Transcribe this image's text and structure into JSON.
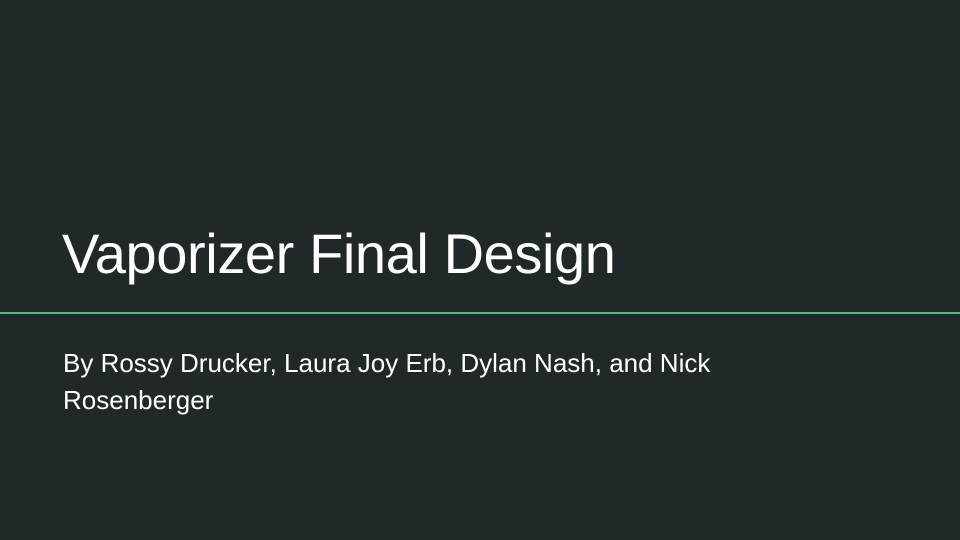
{
  "slide": {
    "title": "Vaporizer Final Design",
    "subtitle": "By Rossy Drucker, Laura Joy Erb, Dylan Nash, and Nick Rosenberger"
  },
  "colors": {
    "background": "#212829",
    "text": "#ffffff",
    "accent": "#5fb67c"
  }
}
